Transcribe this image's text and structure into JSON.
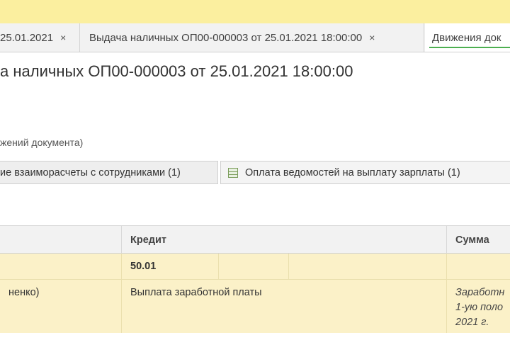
{
  "tabs": [
    {
      "label": "25.01.2021",
      "close": "×"
    },
    {
      "label": "Выдача наличных ОП00-000003 от 25.01.2021 18:00:00",
      "close": "×"
    },
    {
      "label": "Движения док"
    }
  ],
  "page": {
    "title": "а наличных ОП00-000003 от 25.01.2021 18:00:00",
    "subtitle": "жений документа)"
  },
  "registers": [
    {
      "label": "ие взаиморасчеты с сотрудниками (1)"
    },
    {
      "label": "Оплата ведомостей на выплату зарплаты (1)"
    }
  ],
  "grid": {
    "headers": [
      "",
      "Кредит",
      "Сумма"
    ],
    "rows": [
      {
        "debit": "",
        "credit": "50.01",
        "amount": ""
      },
      {
        "debit": "ненко)",
        "credit": "Выплата заработной платы",
        "amount_lines": [
          "Заработн",
          "1-ую поло",
          "2021 г."
        ]
      }
    ]
  },
  "colors": {
    "topbar": "#fbef9f",
    "row_highlight": "#fbf1c8",
    "active_tab_underline": "#4caf50"
  }
}
